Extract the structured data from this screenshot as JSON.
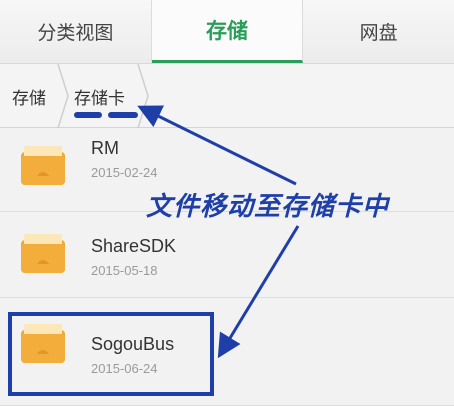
{
  "tabs": [
    {
      "label": "分类视图",
      "active": false
    },
    {
      "label": "存储",
      "active": true
    },
    {
      "label": "网盘",
      "active": false
    }
  ],
  "breadcrumb": [
    {
      "label": "存储"
    },
    {
      "label": "存储卡"
    }
  ],
  "files": [
    {
      "name": "RM",
      "date": "2015-02-24"
    },
    {
      "name": "ShareSDK",
      "date": "2015-05-18"
    },
    {
      "name": "SogouBus",
      "date": "2015-06-24"
    }
  ],
  "annotation": {
    "text": "文件移动至存储卡中",
    "color": "#1f3fa8"
  },
  "colors": {
    "accent": "#2a9d5a",
    "folder": "#f0a830"
  },
  "icons": [
    "folder-icon",
    "android-icon"
  ]
}
